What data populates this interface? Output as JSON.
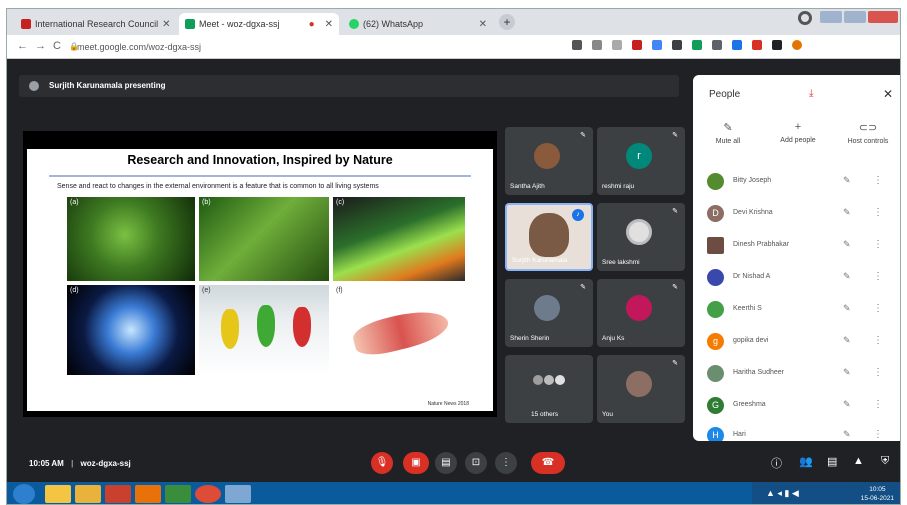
{
  "browser": {
    "tabs": [
      {
        "title": "International Research Council",
        "color": "#c5221f"
      },
      {
        "title": "Meet - woz-dgxa-ssj",
        "color": "#0f9d58",
        "active": true
      },
      {
        "title": "(62) WhatsApp",
        "color": "#25d366"
      }
    ],
    "new_tab": "+",
    "url": "meet.google.com/woz-dgxa-ssj"
  },
  "meet": {
    "presenting_text": "Surjith Karunamala presenting",
    "meeting_code": "woz-dgxa-ssj",
    "time": "10:05 AM",
    "slide": {
      "title": "Research and Innovation, Inspired by Nature",
      "subtitle": "Sense and react to changes in the external environment is a feature that is common to all living systems",
      "panel_labels": [
        "(a)",
        "(b)",
        "(c)",
        "(d)",
        "(e)",
        "(f)"
      ],
      "citation": "Nature News 2018"
    },
    "tiles": [
      {
        "name": "Santha Ajith",
        "color": "#8a5a3c"
      },
      {
        "name": "reshmi raju",
        "color": "#00897b",
        "initial": "r"
      },
      {
        "name": "Surjith Karunamala",
        "color": "#7a6a5c"
      },
      {
        "name": "Sree lakshmi",
        "color": "#9e9e9e"
      },
      {
        "name": "Sherin Sherin",
        "color": "#6d7b8d"
      },
      {
        "name": "Anju Ks",
        "color": "#c2185b"
      },
      {
        "name": "15 others",
        "color": "#5f6368"
      },
      {
        "name": "You",
        "color": "#8d6e63"
      }
    ],
    "people_panel": {
      "title": "People",
      "actions": [
        "Mute all",
        "Add people",
        "Host controls"
      ],
      "participants": [
        {
          "name": "Bitty Joseph",
          "color": "#558b2f"
        },
        {
          "name": "Devi Krishna",
          "color": "#8d6e63",
          "initial": "D"
        },
        {
          "name": "Dinesh Prabhakar",
          "color": "#6d4c41"
        },
        {
          "name": "Dr Nishad A",
          "color": "#3949ab"
        },
        {
          "name": "Keerthi S",
          "color": "#43a047"
        },
        {
          "name": "gopika devi",
          "color": "#f57c00",
          "initial": "g"
        },
        {
          "name": "Haritha Sudheer",
          "color": "#6a8f6f"
        },
        {
          "name": "Greeshma",
          "color": "#2e7d32",
          "initial": "G"
        },
        {
          "name": "Hari",
          "color": "#1e88e5",
          "initial": "H"
        }
      ]
    }
  },
  "taskbar": {
    "time": "10:05",
    "date": "15-06-2021"
  }
}
